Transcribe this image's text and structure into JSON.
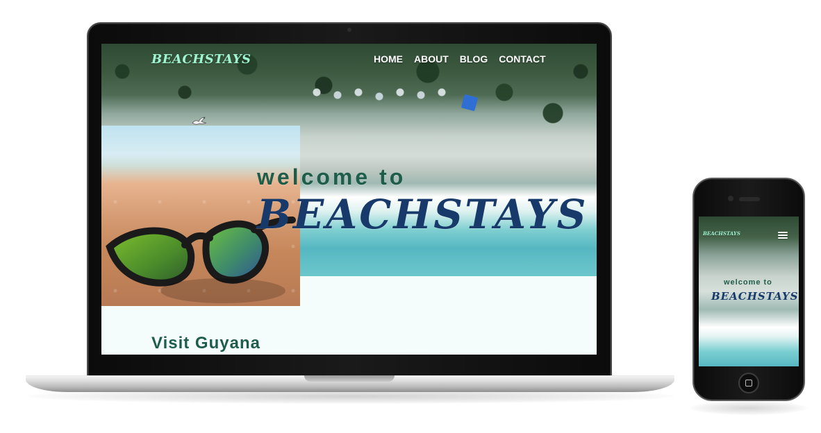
{
  "laptop_site": {
    "logo": "BEACHSTAYS",
    "nav": {
      "home": "HOME",
      "about": "ABOUT",
      "blog": "BLOG",
      "contact": "CONTACT"
    },
    "hero": {
      "welcome": "welcome to",
      "brand": "BEACHSTAYS"
    },
    "section_title": "Visit Guyana"
  },
  "phone_site": {
    "logo": "BEACHSTAYS",
    "hero": {
      "welcome": "welcome to",
      "brand": "BEACHSTAYS"
    }
  },
  "colors": {
    "mint": "#9ff4d2",
    "green": "#1f5d4b",
    "navy": "#183a6a",
    "white": "#ffffff"
  },
  "icons": {
    "bird": "bird-icon",
    "hamburger": "hamburger-menu-icon"
  }
}
